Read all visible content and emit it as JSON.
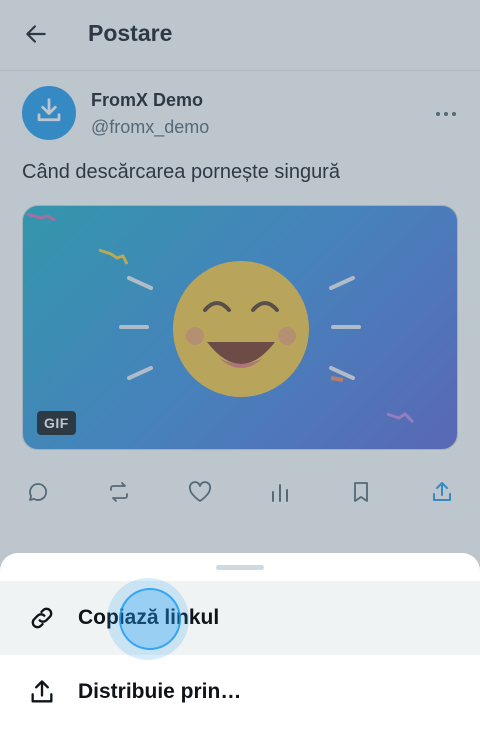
{
  "header": {
    "title": "Postare",
    "back_icon": "arrow-left-icon"
  },
  "post": {
    "author_name": "FromX Demo",
    "author_handle": "@fromx_demo",
    "text": "Când descărcarea pornește singură",
    "media_badge": "GIF",
    "avatar_icon": "download-icon",
    "more_icon": "more-horizontal-icon"
  },
  "actions": [
    {
      "name": "reply",
      "icon": "comment-icon"
    },
    {
      "name": "repost",
      "icon": "repost-icon"
    },
    {
      "name": "like",
      "icon": "heart-icon"
    },
    {
      "name": "views",
      "icon": "bar-chart-icon"
    },
    {
      "name": "bookmark",
      "icon": "bookmark-icon"
    },
    {
      "name": "share",
      "icon": "share-icon"
    }
  ],
  "sheet": {
    "items": [
      {
        "label": "Copiază linkul",
        "icon": "link-icon"
      },
      {
        "label": "Distribuie prin…",
        "icon": "share-icon"
      }
    ]
  },
  "colors": {
    "accent": "#1d9bf0",
    "text_primary": "#0f1419",
    "text_secondary": "#536471",
    "overlay": "#5b7083",
    "emoji_face": "#f7c942"
  }
}
